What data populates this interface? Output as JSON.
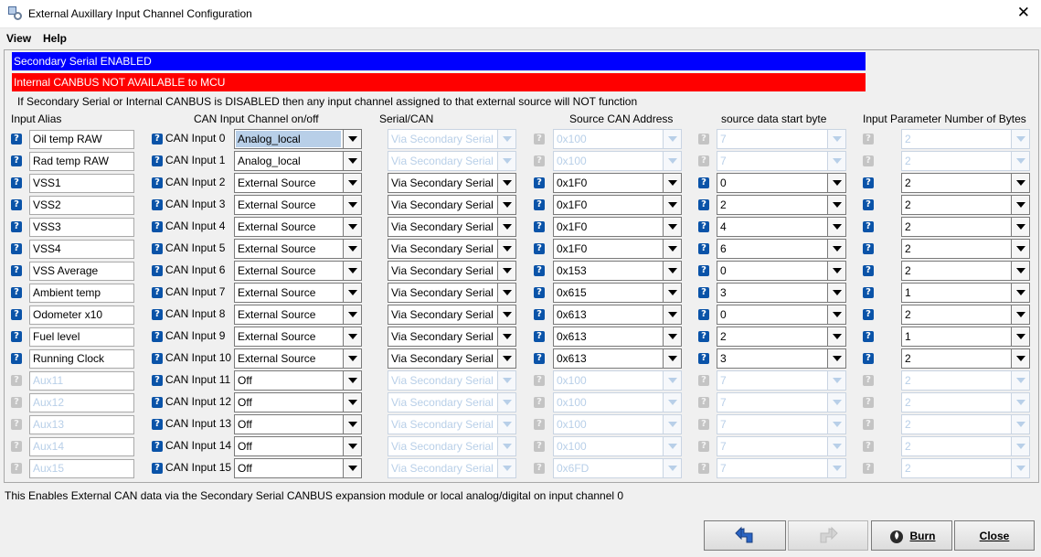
{
  "window": {
    "title": "External Auxillary Input Channel Configuration",
    "close_glyph": "✕"
  },
  "menu": {
    "items": [
      "View",
      "Help"
    ]
  },
  "banners": {
    "serial": {
      "text": "Secondary Serial ENABLED",
      "color": "#0000ff"
    },
    "canbus": {
      "text": "Internal CANBUS NOT AVAILABLE to MCU",
      "color": "#ff0000"
    }
  },
  "warning": "If Secondary Serial or Internal CANBUS is DISABLED then any input channel assigned to that external source will NOT function",
  "headers": {
    "alias": "Input Alias",
    "channel": "CAN Input Channel on/off",
    "serial": "Serial/CAN",
    "address": "Source CAN Address",
    "start": "source data start byte",
    "bytes": "Input Parameter Number of Bytes"
  },
  "help_icon": "help-icon",
  "help_glyph": "?",
  "rows": [
    {
      "alias": "Oil temp RAW",
      "alias_enabled": true,
      "channel": "CAN Input 0",
      "source": "Analog_local",
      "source_selected": true,
      "serial": "Via Secondary Serial",
      "address": "0x100",
      "start": "7",
      "bytes": "2",
      "ext_enabled": false
    },
    {
      "alias": "Rad temp RAW",
      "alias_enabled": true,
      "channel": "CAN Input 1",
      "source": "Analog_local",
      "source_selected": false,
      "serial": "Via Secondary Serial",
      "address": "0x100",
      "start": "7",
      "bytes": "2",
      "ext_enabled": false
    },
    {
      "alias": "VSS1",
      "alias_enabled": true,
      "channel": "CAN Input 2",
      "source": "External Source",
      "source_selected": false,
      "serial": "Via Secondary Serial",
      "address": "0x1F0",
      "start": "0",
      "bytes": "2",
      "ext_enabled": true
    },
    {
      "alias": "VSS2",
      "alias_enabled": true,
      "channel": "CAN Input 3",
      "source": "External Source",
      "source_selected": false,
      "serial": "Via Secondary Serial",
      "address": "0x1F0",
      "start": "2",
      "bytes": "2",
      "ext_enabled": true
    },
    {
      "alias": "VSS3",
      "alias_enabled": true,
      "channel": "CAN Input 4",
      "source": "External Source",
      "source_selected": false,
      "serial": "Via Secondary Serial",
      "address": "0x1F0",
      "start": "4",
      "bytes": "2",
      "ext_enabled": true
    },
    {
      "alias": "VSS4",
      "alias_enabled": true,
      "channel": "CAN Input 5",
      "source": "External Source",
      "source_selected": false,
      "serial": "Via Secondary Serial",
      "address": "0x1F0",
      "start": "6",
      "bytes": "2",
      "ext_enabled": true
    },
    {
      "alias": "VSS Average",
      "alias_enabled": true,
      "channel": "CAN Input 6",
      "source": "External Source",
      "source_selected": false,
      "serial": "Via Secondary Serial",
      "address": "0x153",
      "start": "0",
      "bytes": "2",
      "ext_enabled": true
    },
    {
      "alias": "Ambient temp",
      "alias_enabled": true,
      "channel": "CAN Input 7",
      "source": "External Source",
      "source_selected": false,
      "serial": "Via Secondary Serial",
      "address": "0x615",
      "start": "3",
      "bytes": "1",
      "ext_enabled": true
    },
    {
      "alias": "Odometer x10",
      "alias_enabled": true,
      "channel": "CAN Input 8",
      "source": "External Source",
      "source_selected": false,
      "serial": "Via Secondary Serial",
      "address": "0x613",
      "start": "0",
      "bytes": "2",
      "ext_enabled": true
    },
    {
      "alias": "Fuel level",
      "alias_enabled": true,
      "channel": "CAN Input 9",
      "source": "External Source",
      "source_selected": false,
      "serial": "Via Secondary Serial",
      "address": "0x613",
      "start": "2",
      "bytes": "1",
      "ext_enabled": true
    },
    {
      "alias": "Running Clock",
      "alias_enabled": true,
      "channel": "CAN Input 10",
      "source": "External Source",
      "source_selected": false,
      "serial": "Via Secondary Serial",
      "address": "0x613",
      "start": "3",
      "bytes": "2",
      "ext_enabled": true
    },
    {
      "alias": "Aux11",
      "alias_enabled": false,
      "channel": "CAN Input 11",
      "source": "Off",
      "source_selected": false,
      "serial": "Via Secondary Serial",
      "address": "0x100",
      "start": "7",
      "bytes": "2",
      "ext_enabled": false
    },
    {
      "alias": "Aux12",
      "alias_enabled": false,
      "channel": "CAN Input 12",
      "source": "Off",
      "source_selected": false,
      "serial": "Via Secondary Serial",
      "address": "0x100",
      "start": "7",
      "bytes": "2",
      "ext_enabled": false
    },
    {
      "alias": "Aux13",
      "alias_enabled": false,
      "channel": "CAN Input 13",
      "source": "Off",
      "source_selected": false,
      "serial": "Via Secondary Serial",
      "address": "0x100",
      "start": "7",
      "bytes": "2",
      "ext_enabled": false
    },
    {
      "alias": "Aux14",
      "alias_enabled": false,
      "channel": "CAN Input 14",
      "source": "Off",
      "source_selected": false,
      "serial": "Via Secondary Serial",
      "address": "0x100",
      "start": "7",
      "bytes": "2",
      "ext_enabled": false
    },
    {
      "alias": "Aux15",
      "alias_enabled": false,
      "channel": "CAN Input 15",
      "source": "Off",
      "source_selected": false,
      "serial": "Via Secondary Serial",
      "address": "0x6FD",
      "start": "7",
      "bytes": "2",
      "ext_enabled": false
    }
  ],
  "status_text": "This Enables External CAN data via the Secondary Serial CANBUS expansion module or local analog/digital on input channel 0",
  "buttons": {
    "undo": {
      "icon": "undo-icon",
      "enabled": true
    },
    "redo": {
      "icon": "redo-icon",
      "enabled": false
    },
    "burn": {
      "label": "Burn",
      "icon": "burn-icon"
    },
    "close": {
      "label": "Close"
    }
  }
}
